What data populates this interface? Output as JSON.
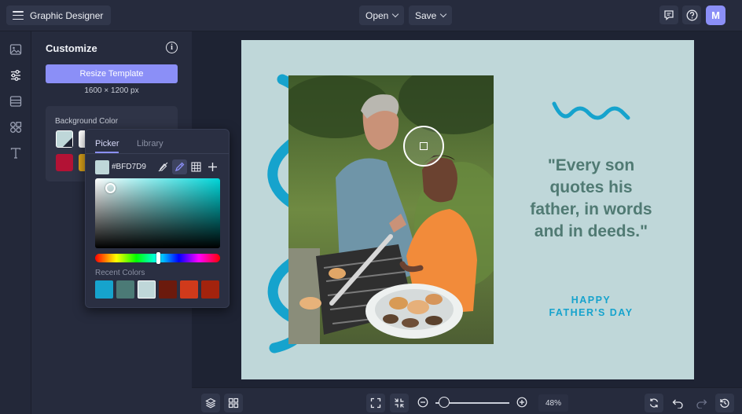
{
  "topbar": {
    "app_title": "Graphic Designer",
    "open_label": "Open",
    "save_label": "Save",
    "avatar_initial": "M"
  },
  "panel": {
    "title": "Customize",
    "resize_button": "Resize Template",
    "dimensions": "1600 × 1200 px",
    "background_color_label": "Background Color"
  },
  "color_picker": {
    "tabs": [
      "Picker",
      "Library"
    ],
    "active_tab": "Picker",
    "hex_value": "#BFD7D9",
    "recent_label": "Recent Colors",
    "recent_colors": [
      "#16a3cd",
      "#4b7a76",
      "#bfd7d9",
      "#6b1a0d",
      "#d03a1b",
      "#a3230d"
    ]
  },
  "artboard": {
    "quote_text": "\"Every son quotes his father, in words and in deeds.\"",
    "happy_line1": "HAPPY",
    "happy_line2": "FATHER'S DAY",
    "background": "#bfd7d9",
    "accent": "#16a3cd"
  },
  "bottombar": {
    "zoom_value": "48%"
  },
  "colors": {
    "brand": "#8b8ff7",
    "panel_bg": "#262b3d",
    "canvas_bg": "#1e2333"
  }
}
